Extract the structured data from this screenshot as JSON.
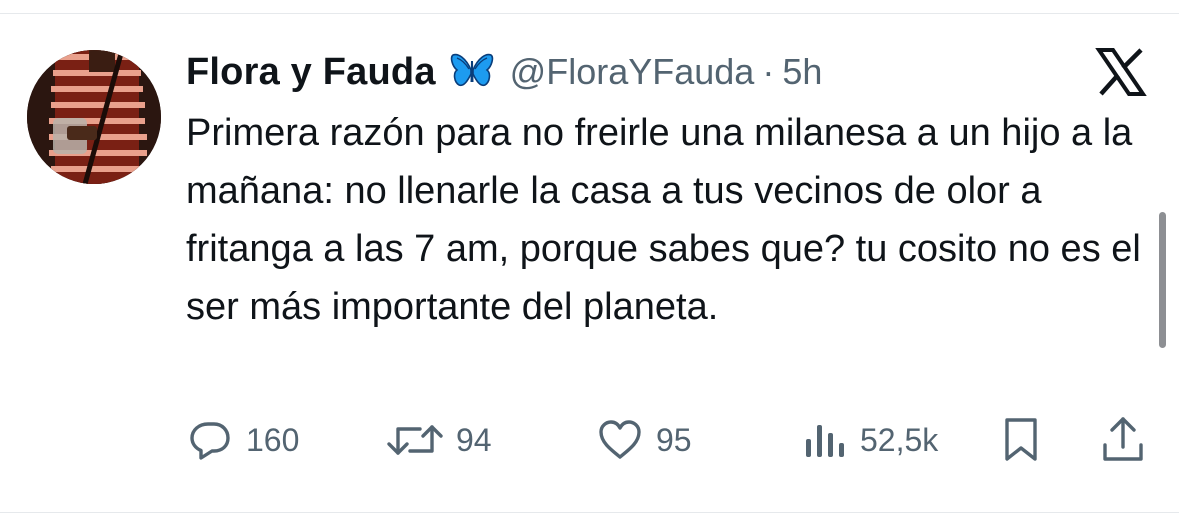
{
  "tweet": {
    "display_name": "Flora y Fauda",
    "handle": "@FloraYFauda",
    "separator": "·",
    "time": "5h",
    "text": "Primera razón para no freirle una milanesa a un hijo a la mañana: no llenarle la casa a tus vecinos de olor a fritanga a las 7 am, porque sabes que? tu cosito no es el ser más importante del planeta.",
    "badge_icon": "butterfly-icon",
    "platform_icon": "x-logo-icon"
  },
  "actions": {
    "replies": "160",
    "reposts": "94",
    "likes": "95",
    "views": "52,5k"
  },
  "colors": {
    "text_primary": "#0f1419",
    "text_secondary": "#536471",
    "butterfly_blue": "#1d9bf0",
    "divider": "#e6e9ec"
  }
}
